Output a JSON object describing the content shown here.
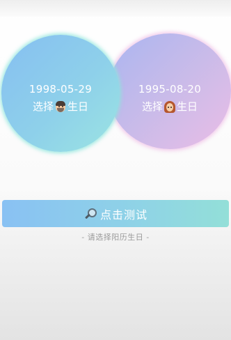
{
  "male": {
    "date": "1998-05-29",
    "prompt_prefix": "选择",
    "prompt_suffix": "生日",
    "emoji_icon": "man-emoji-icon"
  },
  "female": {
    "date": "1995-08-20",
    "prompt_prefix": "选择",
    "prompt_suffix": "生日",
    "emoji_icon": "woman-emoji-icon"
  },
  "action": {
    "button_label": "点击测试",
    "button_icon": "search-icon"
  },
  "hint": "- 请选择阳历生日 -",
  "colors": {
    "male_circle": "#8ecbee",
    "female_circle": "#d1b9ea",
    "button": "#8fd0ea",
    "hint_text": "#9a9a9a"
  }
}
